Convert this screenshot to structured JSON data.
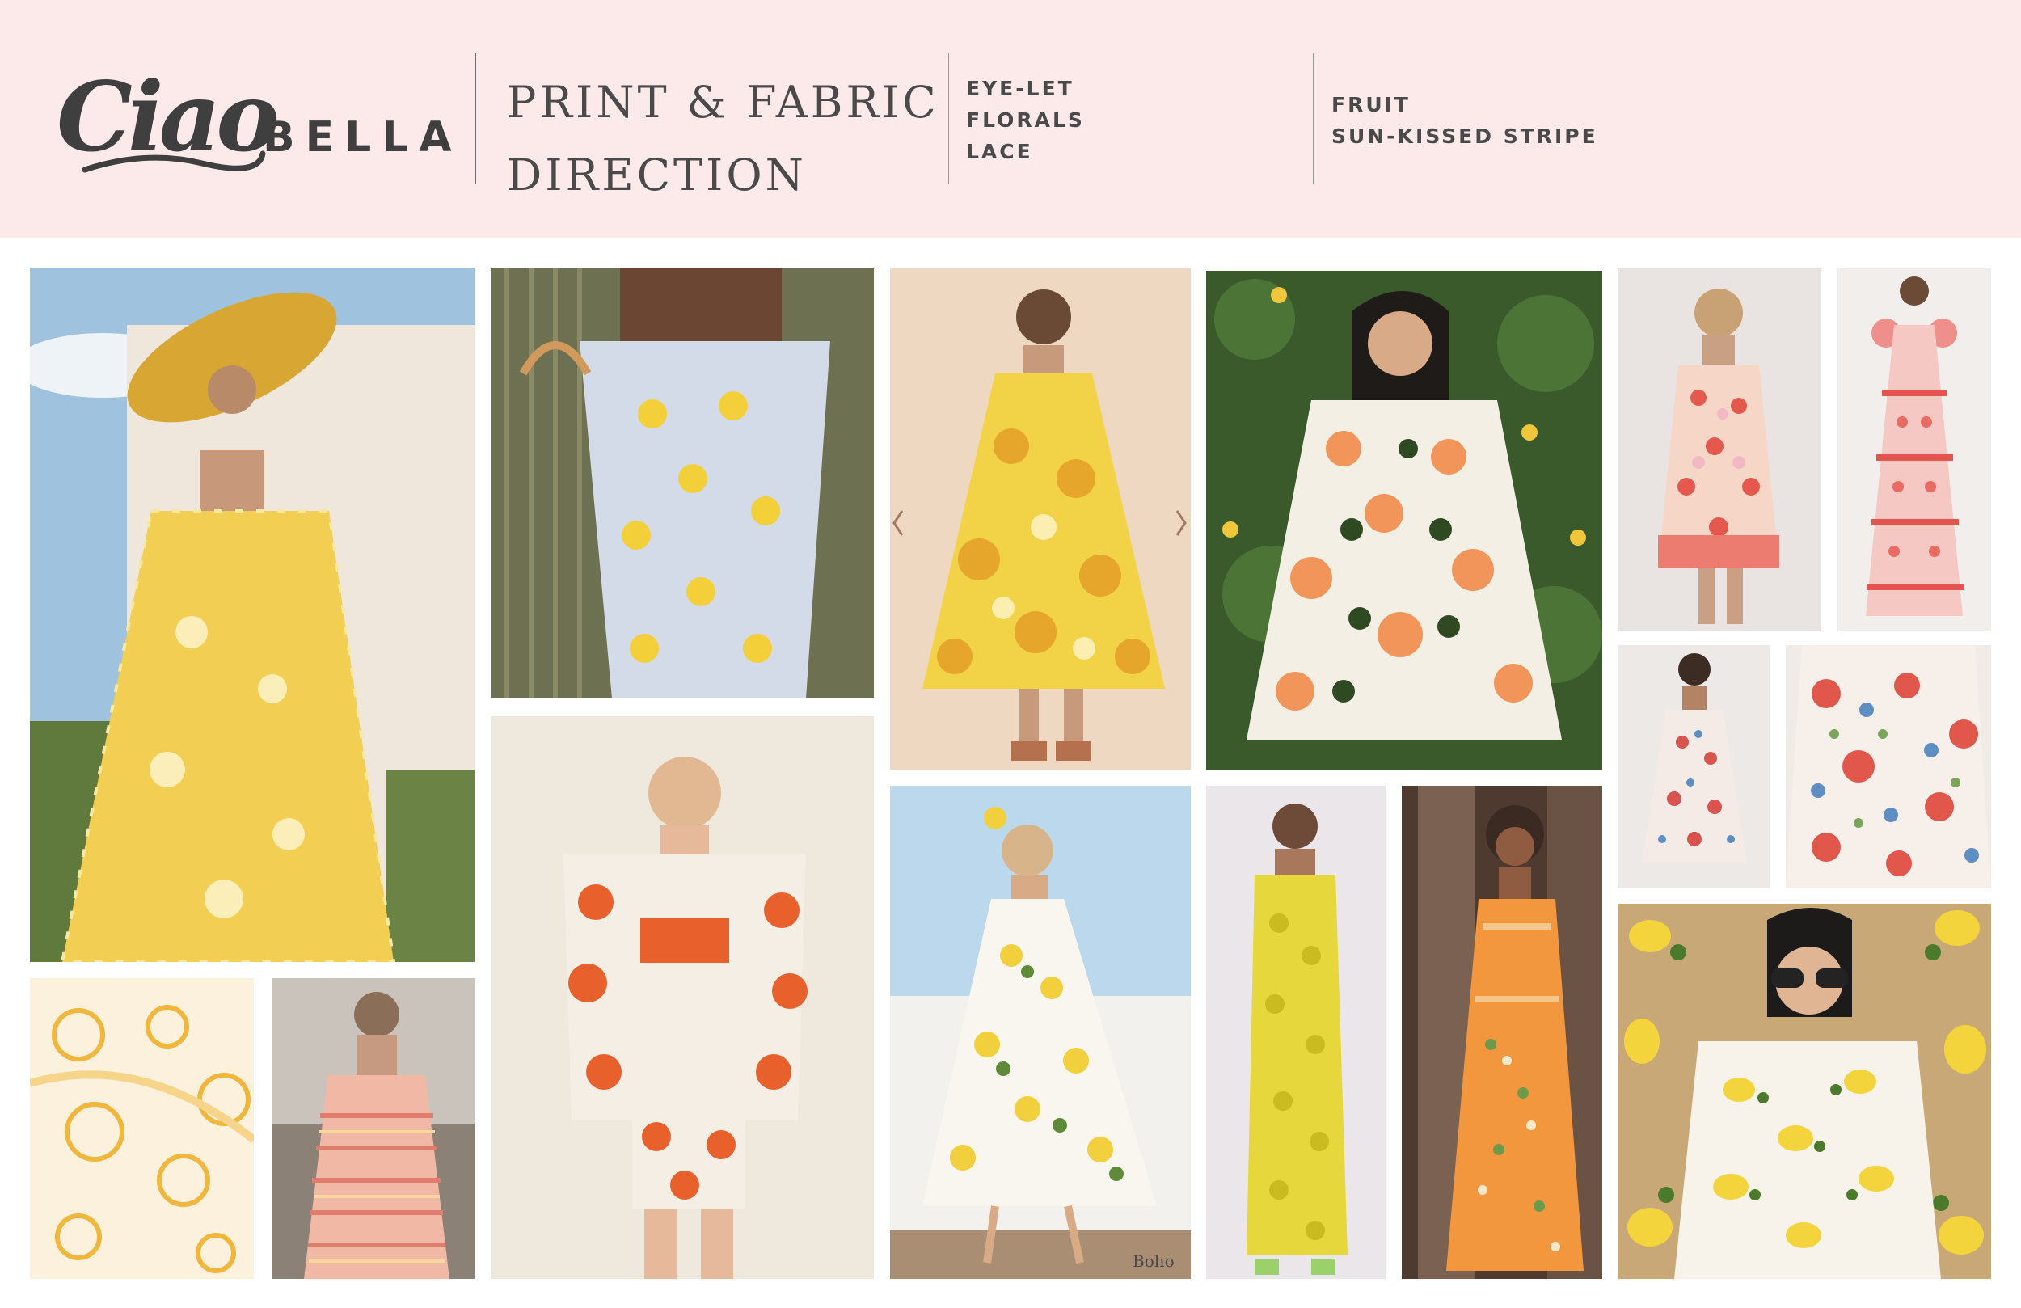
{
  "brand": {
    "script": "Ciao",
    "word": "BELLA"
  },
  "title": {
    "line1": "PRINT & FABRIC",
    "line2": "DIRECTION"
  },
  "tags_group_1": [
    "EYE-LET",
    "FLORALS",
    "LACE"
  ],
  "tags_group_2": [
    "FRUIT",
    "SUN-KISSED STRIPE"
  ],
  "colors": {
    "header_bg": "#fce9ea",
    "text": "#4a4a4a",
    "logo": "#3f3f3f",
    "lemon_yellow": "#f2c62b",
    "coral": "#e8602c",
    "blush": "#f3c1b9"
  },
  "watermark": "Boho"
}
